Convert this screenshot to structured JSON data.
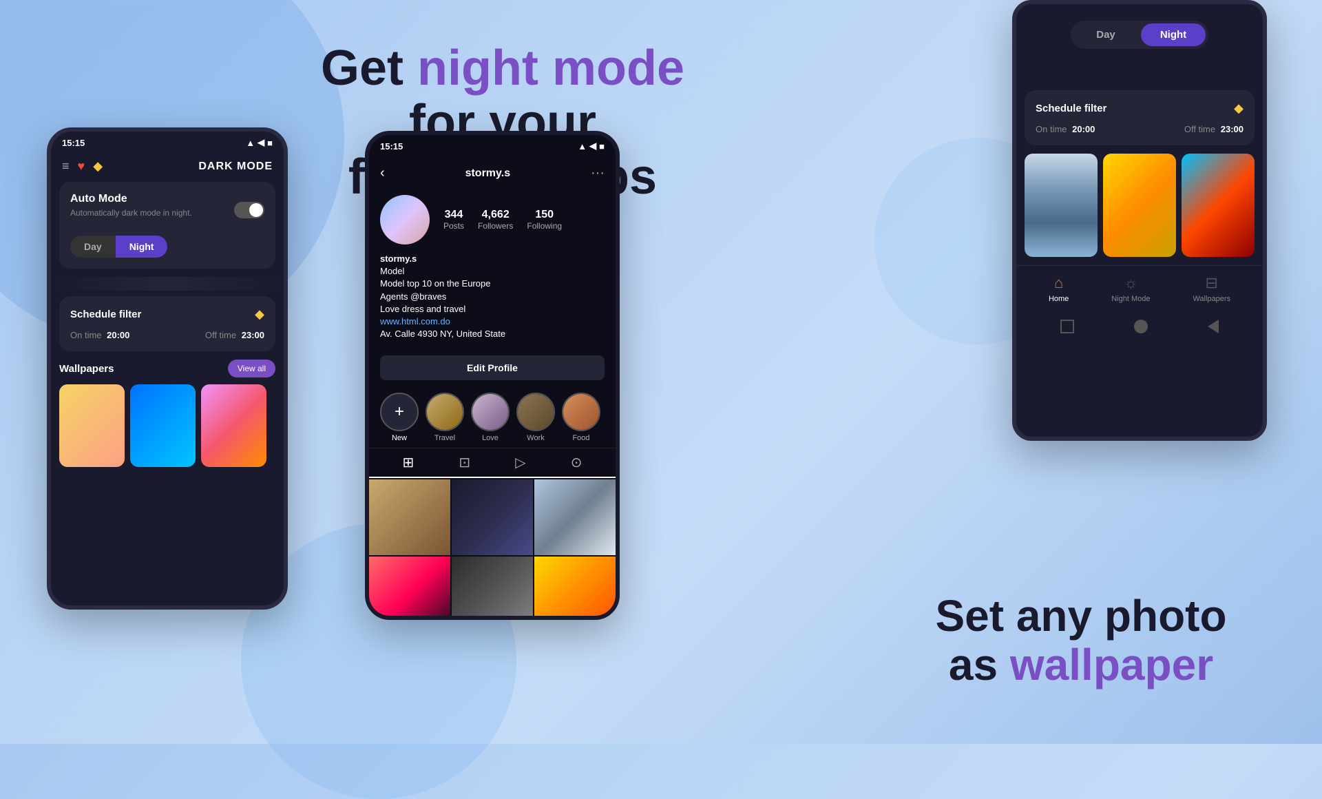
{
  "background": {
    "color": "#a8c8f0"
  },
  "header": {
    "line1_plain_start": "Get ",
    "line1_purple": "night mode",
    "line1_plain_end": " for your",
    "line2": "favorite apps"
  },
  "bottom": {
    "line1": "Set any photo",
    "line2_plain": "as ",
    "line2_purple": "wallpaper"
  },
  "left_phone": {
    "status_bar": {
      "time": "15:15",
      "signal": "▲◀■"
    },
    "title": "DARK MODE",
    "auto_mode": {
      "title": "Auto Mode",
      "subtitle": "Automatically dark mode in night."
    },
    "day_night": {
      "day_label": "Day",
      "night_label": "Night"
    },
    "schedule": {
      "title": "Schedule filter",
      "on_time_label": "On time",
      "on_time_value": "20:00",
      "off_time_label": "Off time",
      "off_time_value": "23:00"
    },
    "wallpapers": {
      "title": "Wallpapers",
      "view_all": "View all"
    }
  },
  "middle_phone": {
    "status_bar": {
      "time": "15:15"
    },
    "username": "stormy.s",
    "stats": {
      "posts": "344",
      "posts_label": "Posts",
      "followers": "4,662",
      "followers_label": "Followers",
      "following": "150",
      "following_label": "Following"
    },
    "bio": {
      "username": "stormy.s",
      "line1": "Model",
      "line2": "Model top 10 on the Europe",
      "line3": "Agents @braves",
      "line4": "Love dress and travel",
      "link": "www.html.com.do",
      "location": "Av. Calle 4930 NY, United State"
    },
    "edit_profile": "Edit Profile",
    "stories": [
      {
        "label": "New"
      },
      {
        "label": "Travel"
      },
      {
        "label": "Love"
      },
      {
        "label": "Work"
      },
      {
        "label": "Food"
      }
    ]
  },
  "right_phone": {
    "day_label": "Day",
    "night_label": "Night",
    "schedule": {
      "title": "Schedule filter",
      "on_time_label": "On time",
      "on_time_value": "20:00",
      "off_time_label": "Off time",
      "off_time_value": "23:00"
    },
    "nav": {
      "home": "Home",
      "night_mode": "Night Mode",
      "wallpapers": "Wallpapers"
    }
  }
}
